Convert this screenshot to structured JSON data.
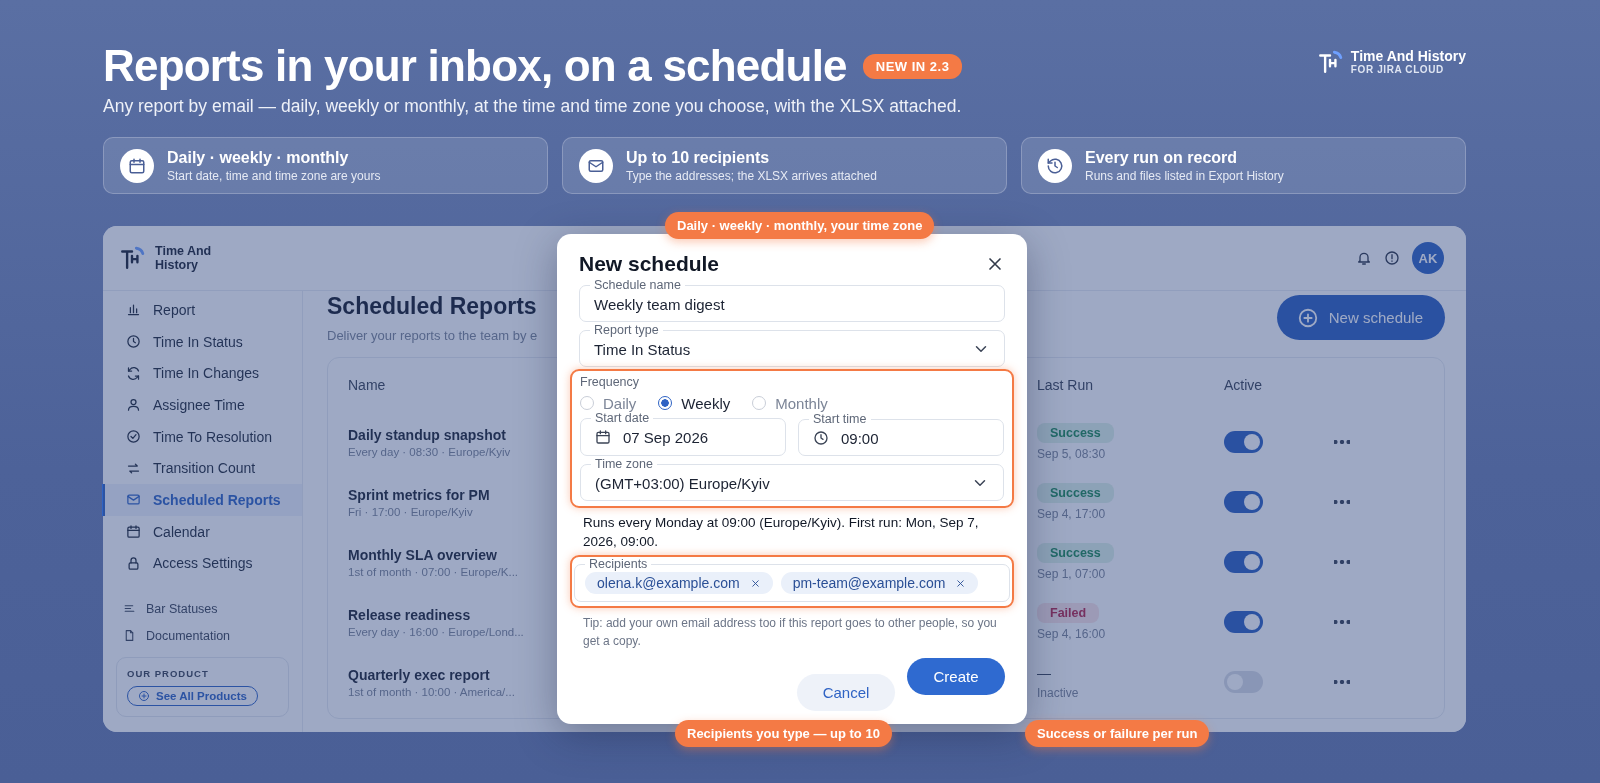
{
  "hero": {
    "title": "Reports in your inbox, on a schedule",
    "badge": "NEW IN 2.3",
    "subtitle": "Any report by email — daily, weekly or monthly, at the time and time zone you choose, with the XLSX attached."
  },
  "brand": {
    "name": "Time And History",
    "tagline": "FOR JIRA CLOUD"
  },
  "features": [
    {
      "title": "Daily · weekly · monthly",
      "text": "Start date, time and time zone are yours"
    },
    {
      "title": "Up to 10 recipients",
      "text": "Type the addresses; the XLSX arrives attached"
    },
    {
      "title": "Every run on record",
      "text": "Runs and files listed in Export History"
    }
  ],
  "app": {
    "brand": "Time And History",
    "avatar": "AK",
    "sidebar": {
      "items": [
        {
          "label": "Report",
          "selected": false
        },
        {
          "label": "Time In Status",
          "selected": false
        },
        {
          "label": "Time In Changes",
          "selected": false
        },
        {
          "label": "Assignee Time",
          "selected": false
        },
        {
          "label": "Time To Resolution",
          "selected": false
        },
        {
          "label": "Transition Count",
          "selected": false
        },
        {
          "label": "Scheduled Reports",
          "selected": true
        },
        {
          "label": "Calendar",
          "selected": false
        },
        {
          "label": "Access Settings",
          "selected": false
        }
      ],
      "secondary": [
        {
          "label": "Bar Statuses"
        },
        {
          "label": "Documentation"
        }
      ],
      "product_box": {
        "heading": "OUR PRODUCT",
        "button": "See All Products"
      }
    },
    "page": {
      "title": "Scheduled Reports",
      "subtitle": "Deliver your reports to the team by e",
      "new_button": "New schedule"
    },
    "table": {
      "columns": [
        "Name",
        "Last Run",
        "Active"
      ],
      "rows": [
        {
          "name": "Daily standup snapshot",
          "detail": "Every day · 08:30 · Europe/Kyiv",
          "status": {
            "label": "Success",
            "kind": "success"
          },
          "last_run": "Sep 5, 08:30",
          "active": true
        },
        {
          "name": "Sprint metrics for PM",
          "detail": "Fri · 17:00 · Europe/Kyiv",
          "status": {
            "label": "Success",
            "kind": "success"
          },
          "last_run": "Sep 4, 17:00",
          "active": true
        },
        {
          "name": "Monthly SLA overview",
          "detail": "1st of month · 07:00 · Europe/K...",
          "status": {
            "label": "Success",
            "kind": "success"
          },
          "last_run": "Sep 1, 07:00",
          "active": true
        },
        {
          "name": "Release readiness",
          "detail": "Every day · 16:00 · Europe/Lond...",
          "status": {
            "label": "Failed",
            "kind": "failed"
          },
          "last_run": "Sep 4, 16:00",
          "active": true
        },
        {
          "name": "Quarterly exec report",
          "detail": "1st of month · 10:00 · America/...",
          "status": {
            "label": "—",
            "kind": "none"
          },
          "last_run": "Inactive",
          "active": false
        }
      ]
    }
  },
  "modal": {
    "title": "New schedule",
    "schedule_name": {
      "label": "Schedule name",
      "value": "Weekly team digest"
    },
    "report_type": {
      "label": "Report type",
      "value": "Time In Status"
    },
    "frequency": {
      "label": "Frequency",
      "options": [
        {
          "label": "Daily",
          "selected": false
        },
        {
          "label": "Weekly",
          "selected": true
        },
        {
          "label": "Monthly",
          "selected": false
        }
      ]
    },
    "start_date": {
      "label": "Start date",
      "value": "07 Sep 2026"
    },
    "start_time": {
      "label": "Start time",
      "value": "09:00"
    },
    "time_zone": {
      "label": "Time zone",
      "value": "(GMT+03:00) Europe/Kyiv"
    },
    "summary": "Runs every Monday at 09:00 (Europe/Kyiv). First run: Mon, Sep 7, 2026, 09:00.",
    "recipients": {
      "label": "Recipients",
      "chips": [
        {
          "label": "olena.k@example.com"
        },
        {
          "label": "pm-team@example.com"
        }
      ]
    },
    "tip": "Tip: add your own email address too if this report goes to other people, so you get a copy.",
    "buttons": [
      {
        "label": "Cancel",
        "kind": "secondary"
      },
      {
        "label": "Create",
        "kind": "primary"
      }
    ]
  },
  "callouts": [
    {
      "label": "Daily · weekly · monthly, your time zone",
      "kind": "top"
    },
    {
      "label": "Recipients you type — up to 10",
      "kind": "bottom-left"
    },
    {
      "label": "Success or failure per run",
      "kind": "bottom-right"
    }
  ]
}
